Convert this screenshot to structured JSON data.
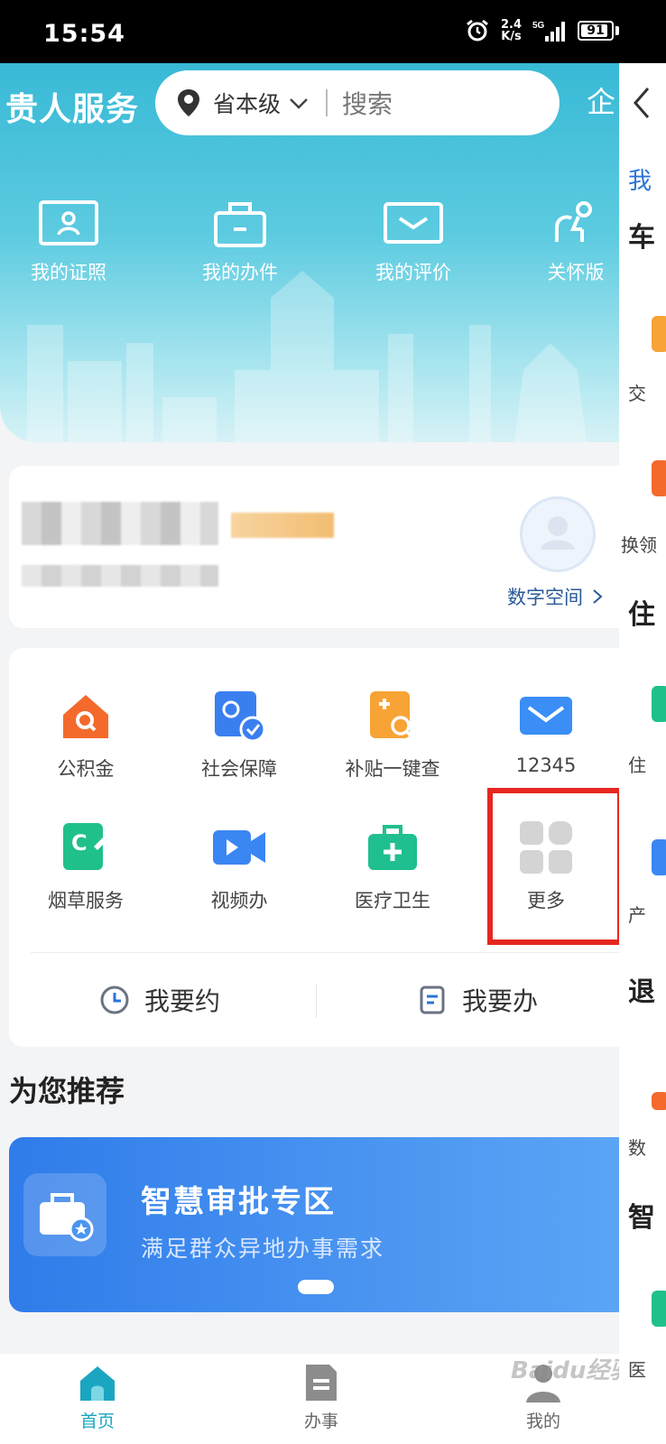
{
  "status_bar": {
    "time": "15:54",
    "net_speed_value": "2.4",
    "net_speed_unit": "K/s",
    "network": "5G",
    "battery": "91",
    "battery_level": 0.91
  },
  "header": {
    "app_title": "贵人服务",
    "region": "省本级",
    "search_placeholder": "搜索",
    "corner_glyph": "企"
  },
  "quick_actions": [
    {
      "label": "我的证照",
      "icon": "id-card-icon"
    },
    {
      "label": "我的办件",
      "icon": "briefcase-icon"
    },
    {
      "label": "我的评价",
      "icon": "mail-icon"
    },
    {
      "label": "关怀版",
      "icon": "care-icon"
    }
  ],
  "profile": {
    "digital_space_label": "数字空间"
  },
  "services": [
    {
      "label": "公积金",
      "icon": "house-fund-icon",
      "color": "#f46a2c"
    },
    {
      "label": "社会保障",
      "icon": "social-security-icon",
      "color": "#3a7ff0"
    },
    {
      "label": "补贴一键查",
      "icon": "subsidy-search-icon",
      "color": "#f7a336"
    },
    {
      "label": "12345",
      "icon": "hotline-mail-icon",
      "color": "#3a8ef6"
    },
    {
      "label": "烟草服务",
      "icon": "tobacco-icon",
      "color": "#20c08a"
    },
    {
      "label": "视频办",
      "icon": "video-icon",
      "color": "#3a86f2"
    },
    {
      "label": "医疗卫生",
      "icon": "medical-kit-icon",
      "color": "#1fbf8f"
    },
    {
      "label": "更多",
      "icon": "more-grid-icon",
      "color": "#cfcfcf"
    }
  ],
  "actions": {
    "appointment": "我要约",
    "handle": "我要办"
  },
  "recommend": {
    "title": "为您推荐",
    "banner_title": "智慧审批专区",
    "banner_subtitle": "满足群众异地办事需求"
  },
  "bottom_nav": [
    {
      "label": "首页",
      "icon": "home-icon",
      "active": true
    },
    {
      "label": "办事",
      "icon": "document-icon",
      "active": false
    },
    {
      "label": "我的",
      "icon": "user-icon",
      "active": false
    }
  ],
  "watermark": "Baidu经验",
  "side_panel": {
    "items": [
      "我",
      "车",
      "交",
      "换领",
      "住",
      "住",
      "产",
      "退",
      "数",
      "智",
      "医"
    ]
  },
  "colors": {
    "accent": "#1aa6c0",
    "highlight_box": "#e6271f",
    "banner": "#3b88ee"
  }
}
